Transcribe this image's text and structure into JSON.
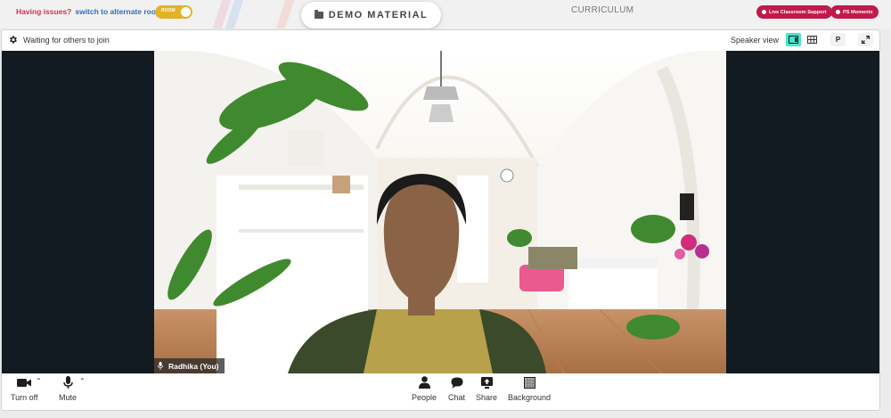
{
  "topbar": {
    "issues_text": "Having issues?",
    "alternate_link": "switch to alternate room",
    "room_toggle_label": "ROOM",
    "demo_button": "DEMO MATERIAL",
    "curriculum": "CURRICULUM",
    "support_button": "Live Classroom Support",
    "moments_button": "PS Moments",
    "colors": {
      "support": "#c2194b",
      "toggle": "#e2b227",
      "link": "#2e6fb7",
      "warn": "#d2324a"
    }
  },
  "meeting": {
    "status": "Waiting for others to join",
    "speaker_view_label": "Speaker view",
    "p_button": "P",
    "active_view": "speaker",
    "accent": "#46e6c5"
  },
  "video": {
    "participant_name": "Radhika (You)"
  },
  "controls": {
    "left": [
      {
        "icon": "camera-icon",
        "label": "Turn off"
      },
      {
        "icon": "microphone-icon",
        "label": "Mute"
      }
    ],
    "center": [
      {
        "icon": "people-icon",
        "label": "People"
      },
      {
        "icon": "chat-icon",
        "label": "Chat"
      },
      {
        "icon": "share-icon",
        "label": "Share"
      },
      {
        "icon": "background-icon",
        "label": "Background"
      }
    ]
  }
}
